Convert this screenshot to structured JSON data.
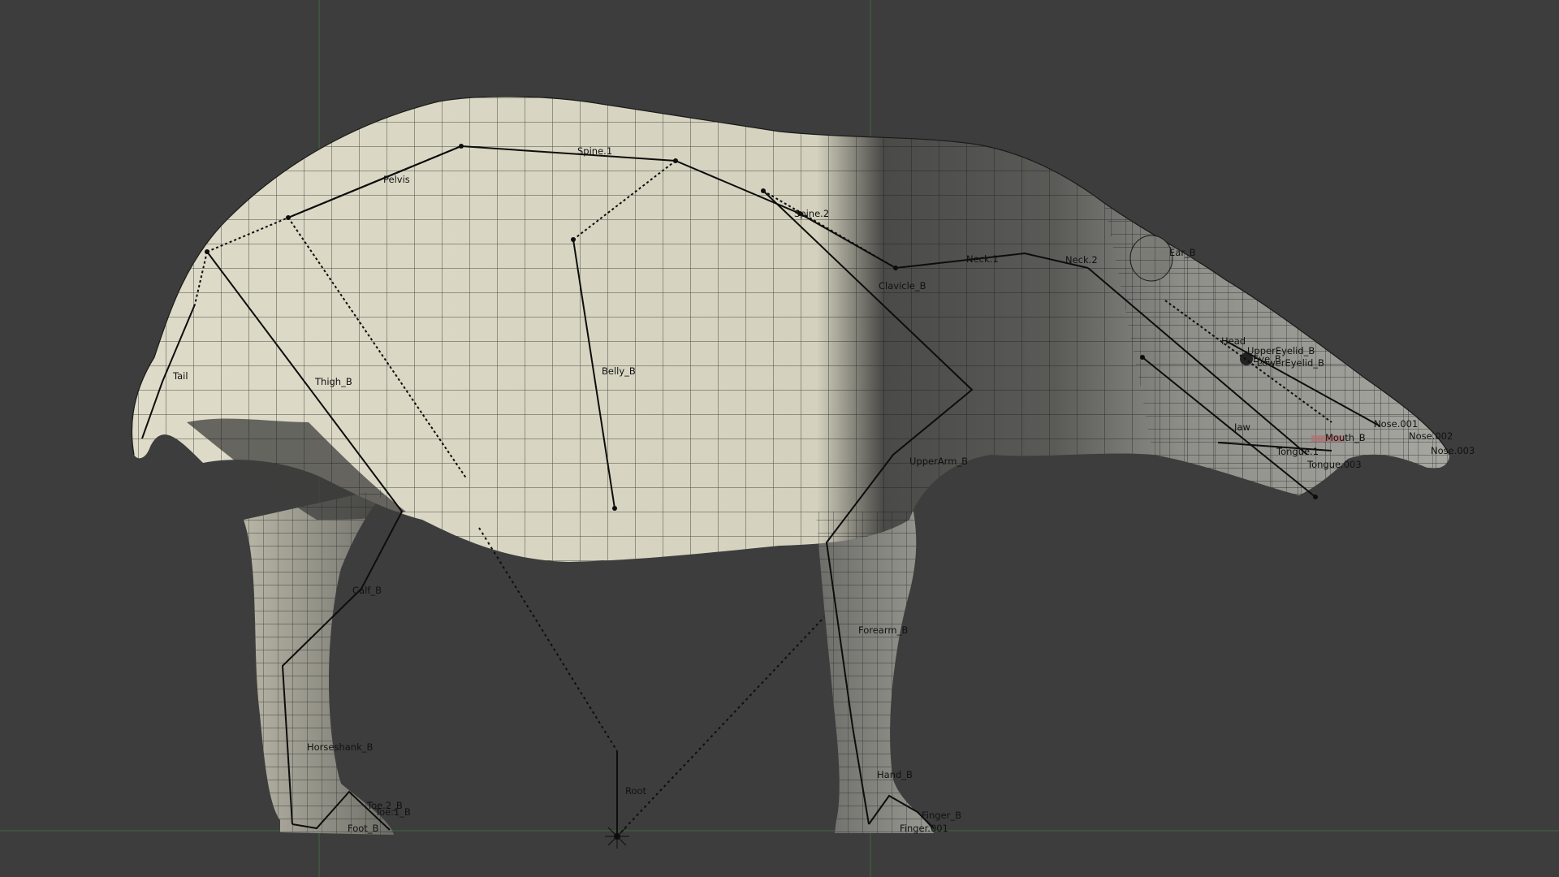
{
  "viewport": {
    "background": "#3d3d3d",
    "grid_line_color": "#3e5a3e",
    "mesh_wire_color": "#1a1a1a"
  },
  "model": {
    "colors": {
      "pale_fur": "#d9d6c2",
      "dark_fur": "#4a4a48",
      "mid_fur": "#8a8a84"
    }
  },
  "bones": {
    "spine_1": "Spine.1",
    "pelvis": "Pelvis",
    "spine_2": "Spine.2",
    "neck_1": "Neck.1",
    "neck_2": "Neck.2",
    "ear_b": "Ear_B",
    "clavicle_b": "Clavicle_B",
    "tail": "Tail",
    "thigh_b": "Thigh_B",
    "belly_b": "Belly_B",
    "head": "Head",
    "upper_eyelid_b": "UpperEyelid_B",
    "eye_b": "Eye_B",
    "lower_eyelid_b": "LowerEyelid_B",
    "nose_001": "Nose.001",
    "nose_002": "Nose.002",
    "nose_003": "Nose.003",
    "jaw": "Jaw",
    "mouth_b": "Mouth_B",
    "tongue_1": "Tongue.1",
    "tongue_003": "Tongue.003",
    "upperarm_b": "UpperArm_B",
    "calf_b": "Calf_B",
    "forearm_b": "Forearm_B",
    "horseshank_b": "Horseshank_B",
    "hand_b": "Hand_B",
    "root": "Root",
    "toe_2_b": "Toe.2_B",
    "toe_1_b": "Toe.1_B",
    "foot_b": "Foot_B",
    "finger_b": "Finger_B",
    "finger_001": "Finger.001"
  }
}
